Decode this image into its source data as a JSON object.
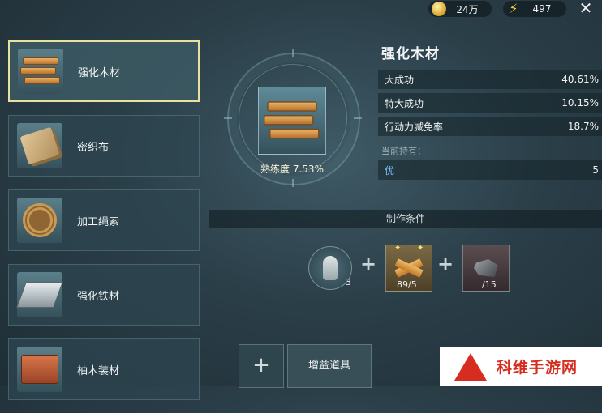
{
  "topbar": {
    "gold": "24万",
    "energy": "497",
    "icons": {
      "gold": "coin-icon",
      "energy": "lightning-icon",
      "close": "close-icon"
    }
  },
  "list": [
    {
      "name": "强化木材",
      "icon": "wood-planks-icon",
      "selected": true
    },
    {
      "name": "密织布",
      "icon": "cloth-icon",
      "selected": false
    },
    {
      "name": "加工绳索",
      "icon": "rope-icon",
      "selected": false
    },
    {
      "name": "强化铁材",
      "icon": "iron-ingot-icon",
      "selected": false
    },
    {
      "name": "柚木装材",
      "icon": "teak-wood-icon",
      "selected": false
    }
  ],
  "center": {
    "proficiency": "熟练度 7.53%"
  },
  "detail": {
    "title": "强化木材",
    "stats": [
      {
        "label": "大成功",
        "value": "40.61%"
      },
      {
        "label": "特大成功",
        "value": "10.15%"
      },
      {
        "label": "行动力减免率",
        "value": "18.7%"
      }
    ],
    "holding_label": "当前持有：",
    "holding_quality": "优",
    "holding_count": "5"
  },
  "craft": {
    "header": "制作条件",
    "materials": [
      {
        "icon": "character-figure-icon",
        "count": "3"
      },
      {
        "icon": "crossed-wood-icon",
        "count": "89/5"
      },
      {
        "icon": "ore-icon",
        "count": "/15"
      }
    ]
  },
  "bottom": {
    "add_symbol": "+",
    "buff_label": "增益道具"
  },
  "watermark": {
    "text": "科维手游网",
    "color": "#d62d20"
  }
}
